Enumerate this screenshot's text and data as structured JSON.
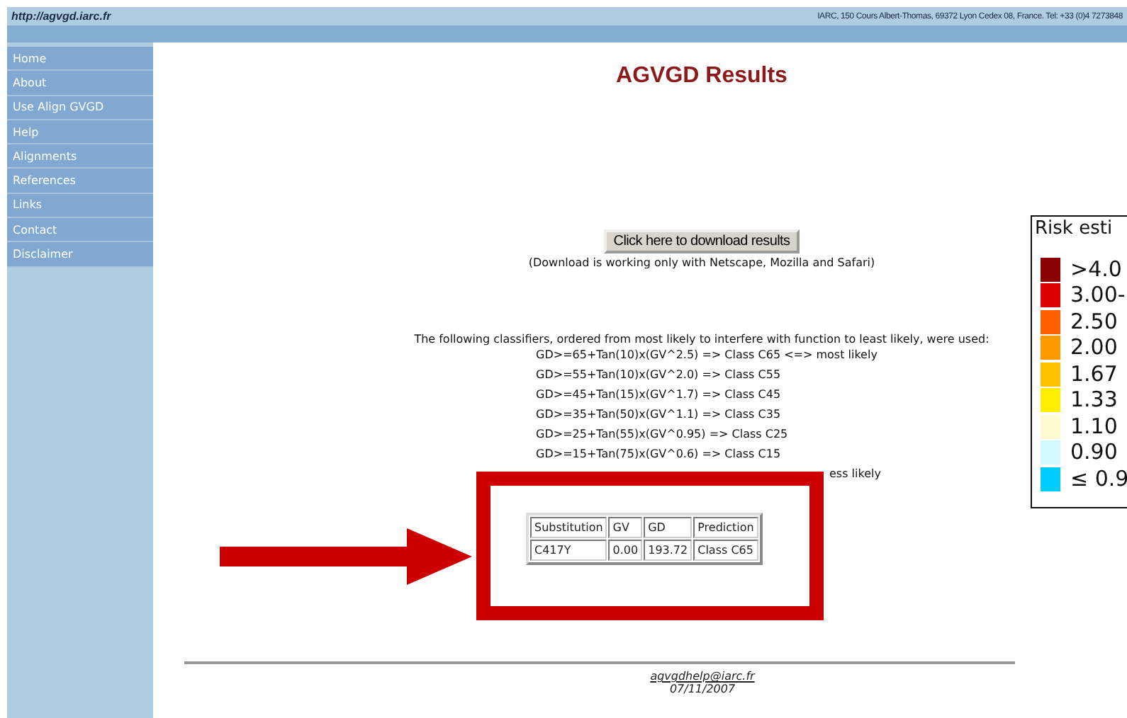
{
  "header": {
    "url": "http://agvgd.iarc.fr",
    "address": "IARC, 150 Cours Albert-Thomas, 69372 Lyon Cedex 08, France. Tel: +33 (0)4 7273848"
  },
  "sidebar": {
    "items": [
      "Home",
      "About",
      "Use Align GVGD",
      "Help",
      "Alignments",
      "References",
      "Links",
      "Contact",
      "Disclaimer"
    ]
  },
  "main": {
    "title": "AGVGD Results",
    "download_button": "Click here to download results",
    "download_note": "(Download is working only with Netscape, Mozilla and Safari)",
    "classifiers_intro": "The following classifiers, ordered from most likely to interfere with function to least likely, were used:",
    "classifiers": [
      "GD>=65+Tan(10)x(GV^2.5) => Class C65 <=> most likely",
      "GD>=55+Tan(10)x(GV^2.0) => Class C55",
      "GD>=45+Tan(15)x(GV^1.7) => Class C45",
      "GD>=35+Tan(50)x(GV^1.1) => Class C35",
      "GD>=25+Tan(55)x(GV^0.95) => Class C25",
      "GD>=15+Tan(75)x(GV^0.6) => Class C15"
    ],
    "classifier_fragment": "ess likely",
    "results_table": {
      "columns": [
        "Substitution",
        "GV",
        "GD",
        "Prediction"
      ],
      "rows": [
        [
          "C417Y",
          "0.00",
          "193.72",
          "Class C65"
        ]
      ]
    }
  },
  "footer": {
    "email": "agvgdhelp@iarc.fr",
    "date": "07/11/2007"
  },
  "legend": {
    "title": "Risk esti",
    "items": [
      {
        "label": ">4.0",
        "color": "#8b0000"
      },
      {
        "label": "3.00-",
        "color": "#dd0000"
      },
      {
        "label": "2.50",
        "color": "#ff6000"
      },
      {
        "label": "2.00",
        "color": "#ff9900"
      },
      {
        "label": "1.67",
        "color": "#ffc000"
      },
      {
        "label": "1.33",
        "color": "#ffee00"
      },
      {
        "label": "1.10",
        "color": "#fffbd0"
      },
      {
        "label": "0.90",
        "color": "#d0f8ff"
      },
      {
        "label": "≤ 0.9",
        "color": "#00ccff"
      }
    ]
  }
}
